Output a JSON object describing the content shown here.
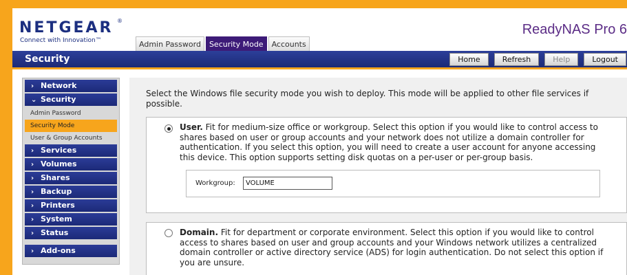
{
  "brand": {
    "logo": "NETGEAR",
    "registered_mark": "®",
    "tagline": "Connect with Innovation™",
    "product": "ReadyNAS Pro 6"
  },
  "tabs": [
    {
      "label": "Admin Password",
      "active": false
    },
    {
      "label": "Security Mode",
      "active": true
    },
    {
      "label": "Accounts",
      "active": false
    }
  ],
  "titlebar": {
    "section": "Security",
    "buttons": [
      "Home",
      "Refresh",
      "Help",
      "Logout"
    ]
  },
  "sidebar": {
    "items": [
      {
        "label": "Network",
        "icon": "chevron-right-icon"
      },
      {
        "label": "Security",
        "icon": "chevron-down-icon"
      },
      {
        "label": "Services",
        "icon": "chevron-right-icon"
      },
      {
        "label": "Volumes",
        "icon": "chevron-right-icon"
      },
      {
        "label": "Shares",
        "icon": "chevron-right-icon"
      },
      {
        "label": "Backup",
        "icon": "chevron-right-icon"
      },
      {
        "label": "Printers",
        "icon": "chevron-right-icon"
      },
      {
        "label": "System",
        "icon": "chevron-right-icon"
      },
      {
        "label": "Status",
        "icon": "chevron-right-icon"
      },
      {
        "label": "Add-ons",
        "icon": "chevron-right-icon"
      }
    ],
    "sub_items": [
      "Admin Password",
      "Security Mode",
      "User & Group Accounts"
    ]
  },
  "content": {
    "intro": "Select the Windows file security mode you wish to deploy. This mode will be applied to other file services if possible.",
    "user_option": {
      "title": "User.",
      "text": " Fit for medium-size office or workgroup. Select this option if you would like to control access to shares based on user or group accounts and your network does not utilize a domain controller for authentication. If you select this option, you will need to create a user account for anyone accessing this device. This option supports setting disk quotas on a per-user or per-group basis.",
      "selected": true,
      "workgroup_label": "Workgroup:",
      "workgroup_value": "VOLUME"
    },
    "domain_option": {
      "title": "Domain.",
      "text": " Fit for department or corporate environment. Select this option if you would like to control access to shares based on user and group accounts and your Windows network utilizes a centralized domain controller or active directory service (ADS) for login authentication. Do not select this option if you are unsure.",
      "selected": false
    }
  },
  "colors": {
    "accent_orange": "#f7a51c",
    "nav_blue": "#1c2a78",
    "active_tab_purple": "#3d1b78"
  }
}
